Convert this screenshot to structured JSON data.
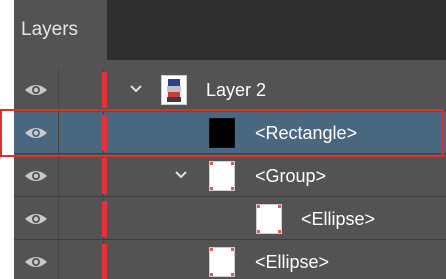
{
  "panel": {
    "tab_label": "Layers",
    "accent_color": "#e8303a",
    "selection_color": "#4a6780",
    "highlight_color": "#d9322d"
  },
  "layers": [
    {
      "label": "Layer 2",
      "icon": "layer-thumbnail",
      "expandable": true,
      "expanded": true,
      "selected": false
    },
    {
      "label": "<Rectangle>",
      "icon": "rectangle-thumbnail",
      "expandable": false,
      "selected": true
    },
    {
      "label": "<Group>",
      "icon": "group-thumbnail",
      "expandable": true,
      "expanded": true,
      "selected": false
    },
    {
      "label": "<Ellipse>",
      "icon": "ellipse-thumbnail",
      "expandable": false,
      "selected": false
    },
    {
      "label": "<Ellipse>",
      "icon": "ellipse-thumbnail",
      "expandable": false,
      "selected": false
    }
  ]
}
